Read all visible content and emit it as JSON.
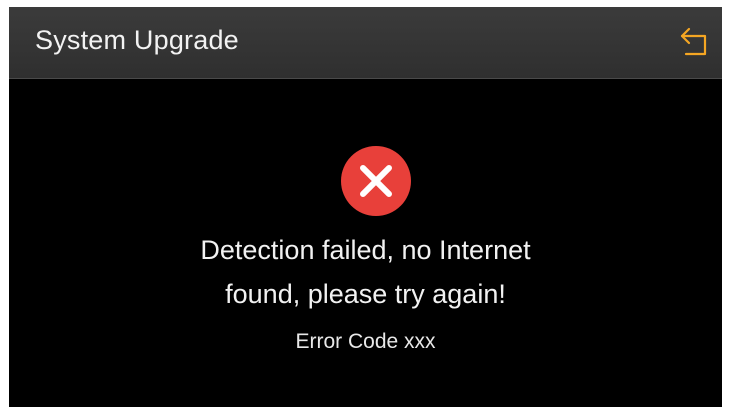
{
  "header": {
    "title": "System Upgrade",
    "back_icon": "back-arrow-icon",
    "back_color": "#f5a623"
  },
  "dialog": {
    "status_icon": "error-x-icon",
    "status_color": "#e8403a",
    "message_line1": "Detection failed, no Internet",
    "message_line2": "found, please try again!",
    "error_code": "Error Code xxx"
  }
}
